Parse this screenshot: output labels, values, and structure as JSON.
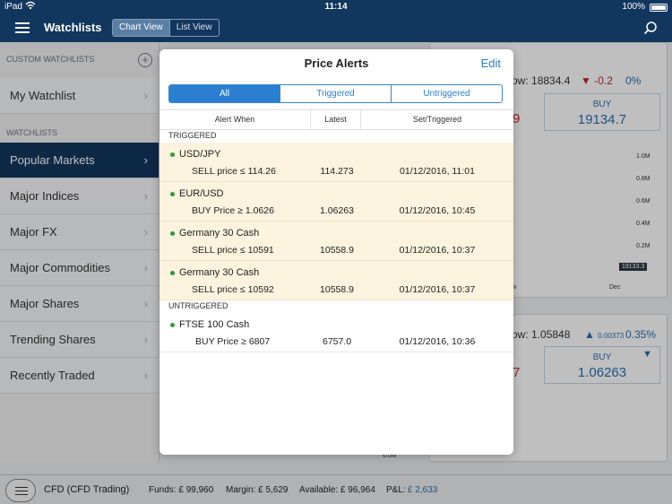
{
  "status_bar": {
    "device": "iPad",
    "time": "11:14",
    "battery": "100%"
  },
  "nav": {
    "title": "Watchlists",
    "view_chart": "Chart View",
    "view_list": "List View"
  },
  "sidebar": {
    "custom_label": "CUSTOM WATCHLISTS",
    "custom_items": [
      {
        "label": "My Watchlist"
      }
    ],
    "watchlists_label": "WATCHLISTS",
    "items": [
      {
        "label": "Popular Markets"
      },
      {
        "label": "Major Indices"
      },
      {
        "label": "Major FX"
      },
      {
        "label": "Major Commodities"
      },
      {
        "label": "Major Shares"
      },
      {
        "label": "Trending Shares"
      },
      {
        "label": "Recently Traded"
      }
    ]
  },
  "background": {
    "market1": {
      "low_label": "ow:",
      "low_value": "18834.4",
      "change": "-0.2",
      "change_pct": "0%",
      "sell_partial": "9",
      "buy_label": "BUY",
      "buy_value": "19134.7",
      "axis": [
        "1.0M",
        "0.8M",
        "0.6M",
        "0.4M",
        "0.2M"
      ],
      "price_tag": "19133.3",
      "month_partial": "v",
      "month": "Dec"
    },
    "market2": {
      "low_label": "ow:",
      "low_value": "1.05848",
      "change": "0.00373",
      "change_pct": "0.35%",
      "sell_partial": "7",
      "buy_label": "BUY",
      "buy_value": "1.06263",
      "axis_bottom": "6.0M"
    }
  },
  "modal": {
    "title": "Price Alerts",
    "edit": "Edit",
    "filters": [
      "All",
      "Triggered",
      "Untriggered"
    ],
    "columns": [
      "Alert When",
      "Latest",
      "Set/Triggered"
    ],
    "triggered_label": "TRIGGERED",
    "untriggered_label": "UNTRIGGERED",
    "triggered": [
      {
        "instrument": "USD/JPY",
        "condition": "SELL price ≤ 114.26",
        "latest": "114.273",
        "time": "01/12/2016, 11:01"
      },
      {
        "instrument": "EUR/USD",
        "condition": "BUY Price ≥ 1.0626",
        "latest": "1.06263",
        "time": "01/12/2016, 10:45"
      },
      {
        "instrument": "Germany 30 Cash",
        "condition": "SELL price ≤ 10591",
        "latest": "10558.9",
        "time": "01/12/2016, 10:37"
      },
      {
        "instrument": "Germany 30 Cash",
        "condition": "SELL price ≤ 10592",
        "latest": "10558.9",
        "time": "01/12/2016, 10:37"
      }
    ],
    "untriggered": [
      {
        "instrument": "FTSE 100 Cash",
        "condition": "BUY Price ≥ 6807",
        "latest": "6757.0",
        "time": "01/12/2016, 10:36"
      }
    ]
  },
  "bottom": {
    "account": "CFD (CFD Trading)",
    "funds": "Funds: £ 99,960",
    "margin": "Margin: £ 5,629",
    "available": "Available: £ 96,964",
    "pl_label": "P&L:",
    "pl_value": "£ 2,633"
  },
  "colors": {
    "navy": "#12375e",
    "accent": "#2a7fd0",
    "triggered_row": "#fcf3de",
    "status_dot": "#2e9a3a"
  }
}
